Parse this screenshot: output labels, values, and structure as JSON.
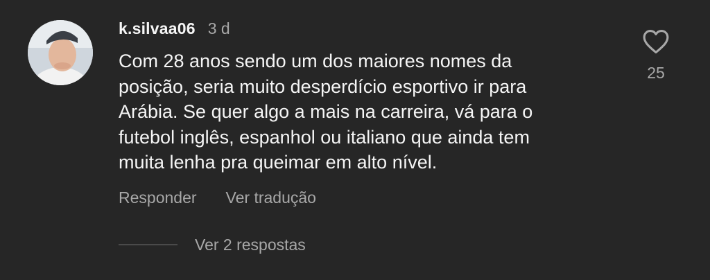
{
  "comment": {
    "username": "k.silvaa06",
    "time": "3 d",
    "text_lines": [
      "Com 28 anos sendo um dos maiores nomes da",
      "posição, seria muito desperdício esportivo ir para",
      "Arábia. Se quer algo a mais na carreira, vá para o",
      "futebol inglês, espanhol ou italiano que ainda tem",
      "muita lenha pra queimar em alto nível."
    ],
    "actions": {
      "reply": "Responder",
      "translate": "Ver tradução"
    },
    "likes": "25",
    "replies_label": "Ver 2 respostas",
    "avatar_icon": "user-avatar",
    "like_icon": "heart-icon"
  },
  "colors": {
    "background": "#262626",
    "text": "#f5f5f5",
    "secondary": "#a8a8a8"
  }
}
